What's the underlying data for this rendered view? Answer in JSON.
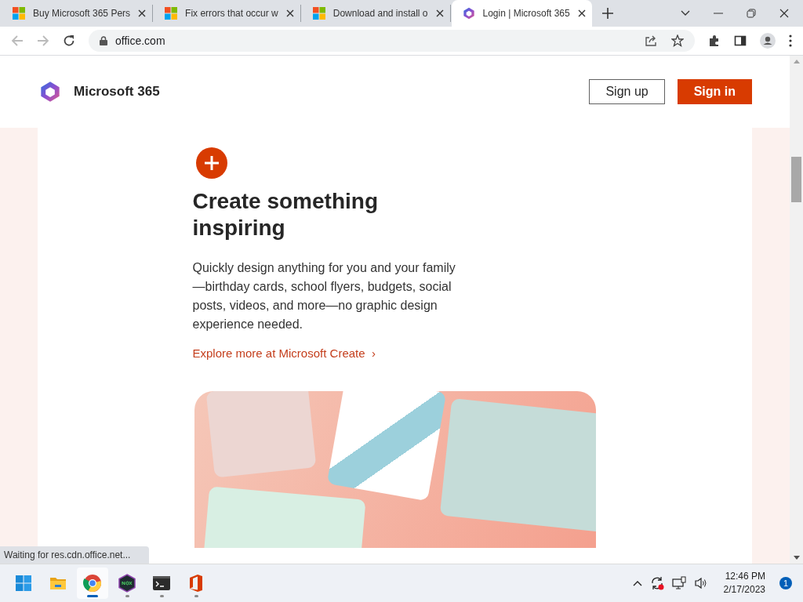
{
  "browser": {
    "tabs": [
      {
        "title": "Buy Microsoft 365 Pers",
        "selected": false
      },
      {
        "title": "Fix errors that occur w",
        "selected": false
      },
      {
        "title": "Download and install o",
        "selected": false
      },
      {
        "title": "Login | Microsoft 365",
        "selected": true
      }
    ],
    "address": "office.com",
    "status": "Waiting for res.cdn.office.net..."
  },
  "page": {
    "brand": "Microsoft 365",
    "buttons": [
      {
        "label": "Sign up",
        "kind": "outline"
      },
      {
        "label": "Sign in",
        "kind": "primary"
      }
    ],
    "heading": "Create something inspiring",
    "body": "Quickly design anything for you and your family—birthday cards, school flyers, budgets, social posts, videos, and more—no graphic design experience needed.",
    "link": "Explore more at Microsoft Create",
    "link_arrow": "›"
  },
  "taskbar": {
    "apps": [
      {
        "kind": "start",
        "running": false,
        "selected": false
      },
      {
        "kind": "folder",
        "running": false,
        "selected": false
      },
      {
        "kind": "chrome",
        "running": true,
        "selected": true
      },
      {
        "kind": "nox",
        "running": true,
        "selected": false
      },
      {
        "kind": "terminal",
        "running": true,
        "selected": false
      },
      {
        "kind": "office",
        "running": true,
        "selected": false
      }
    ],
    "time": "12:46 PM",
    "date": "2/17/2023",
    "notifications": "1"
  }
}
